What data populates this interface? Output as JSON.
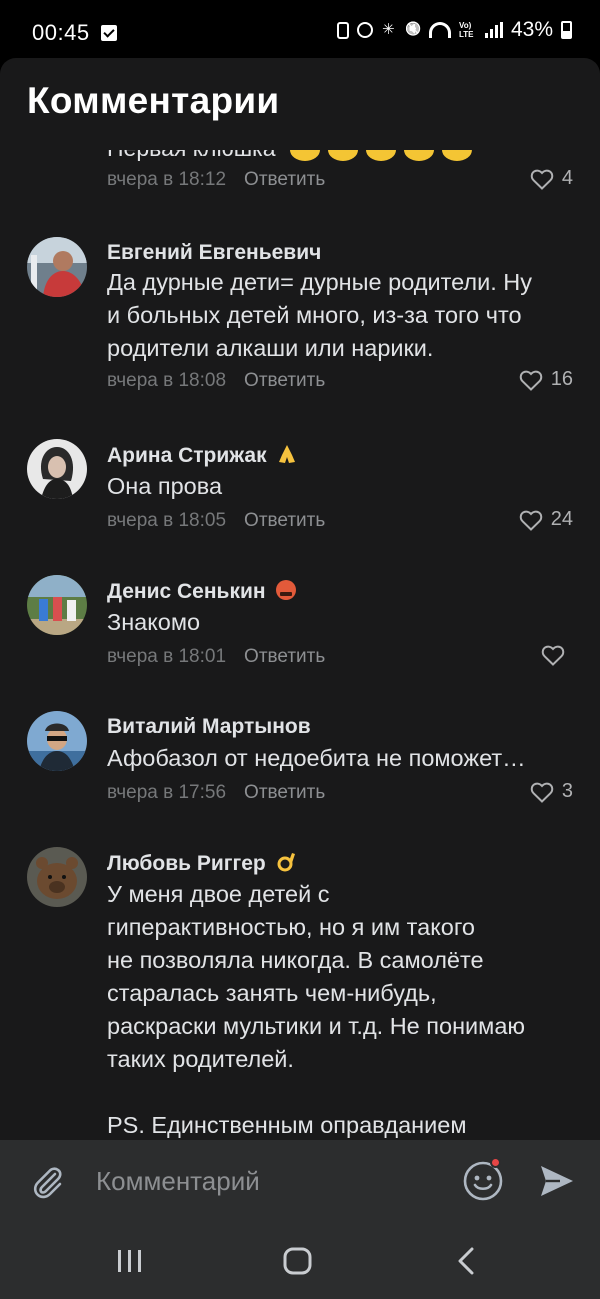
{
  "status_bar": {
    "time": "00:45",
    "battery": "43%"
  },
  "header": {
    "title": "Комментарии"
  },
  "partial_comment": {
    "text": "Первая клюшка",
    "time": "вчера в 18:12",
    "reply": "Ответить",
    "likes": "4"
  },
  "comments": [
    {
      "author": "Евгений Евгеньевич",
      "text": "Да дурные дети= дурные родители. Ну\nи больных детей много, из-за того что\nродители алкаши или нарики.",
      "time": "вчера в 18:08",
      "reply": "Ответить",
      "likes": "16"
    },
    {
      "author": "Арина Стрижак",
      "author_emoji": "folded-hands",
      "text": "Она прова",
      "time": "вчера в 18:05",
      "reply": "Ответить",
      "likes": "24"
    },
    {
      "author": "Денис Сенькин",
      "author_emoji": "angry-face",
      "text": "Знакомо",
      "time": "вчера в 18:01",
      "reply": "Ответить",
      "likes": ""
    },
    {
      "author": "Виталий Мартынов",
      "text": "Афобазол от недоебита не поможет…",
      "time": "вчера в 17:56",
      "reply": "Ответить",
      "likes": "3"
    },
    {
      "author": "Любовь Риггер",
      "author_emoji": "ok-hand",
      "text": "У меня двое детей с\nгиперактивностью, но я им такого\nне позволяла никогда. В самолёте\nстаралась занять чем-нибудь,\nраскраски мультики и т.д. Не понимаю\nтаких родителей.\n\nPS. Единственным оправданием",
      "time": "",
      "reply": "",
      "likes": ""
    }
  ],
  "composer": {
    "placeholder": "Комментарий"
  },
  "colors": {
    "background": "#19191a",
    "composer_bg": "#2c2d2e",
    "text": "#e1e3e6",
    "meta": "#76787a",
    "notification_dot": "#e64646"
  }
}
